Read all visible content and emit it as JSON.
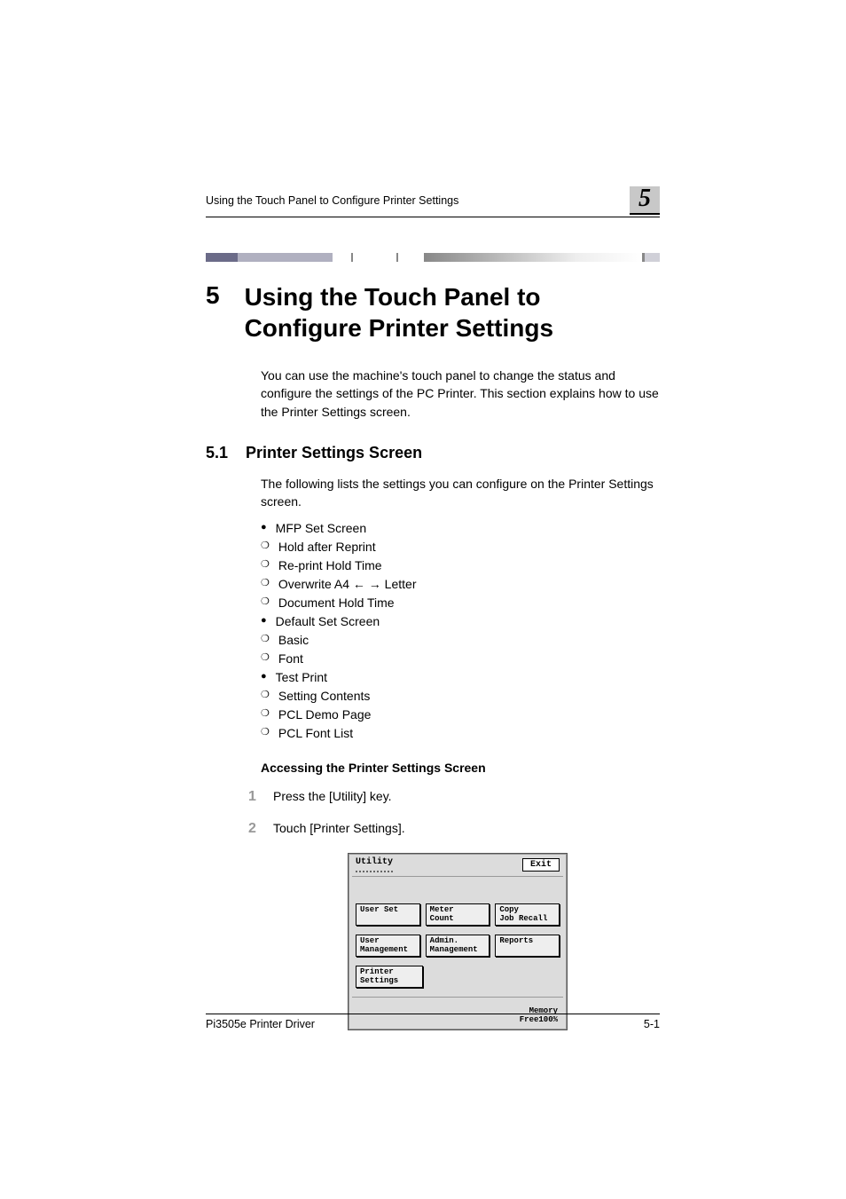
{
  "running_header": {
    "text": "Using the Touch Panel to Configure Printer Settings",
    "chapter_badge": "5"
  },
  "chapter": {
    "number": "5",
    "title": "Using the Touch Panel to Configure Printer Settings"
  },
  "intro": "You can use the machine's touch panel to change the status and configure the settings of the PC Printer. This section explains how to use the Printer Settings screen.",
  "section": {
    "number": "5.1",
    "title": "Printer Settings Screen",
    "para": "The following lists the settings you can configure on the Printer Settings screen."
  },
  "settings": [
    {
      "style": "solid",
      "text": "MFP Set Screen"
    },
    {
      "style": "open",
      "text": "Hold after Reprint"
    },
    {
      "style": "open",
      "text": "Re-print Hold Time"
    },
    {
      "style": "open",
      "text": "Overwrite A4 ← → Letter"
    },
    {
      "style": "open",
      "text": "Document Hold Time"
    },
    {
      "style": "solid",
      "text": "Default Set Screen"
    },
    {
      "style": "open",
      "text": "Basic"
    },
    {
      "style": "open",
      "text": "Font"
    },
    {
      "style": "solid",
      "text": "Test Print"
    },
    {
      "style": "open",
      "text": "Setting Contents"
    },
    {
      "style": "open",
      "text": "PCL Demo Page"
    },
    {
      "style": "open",
      "text": "PCL Font List"
    }
  ],
  "subsection_heading": "Accessing the Printer Settings Screen",
  "steps": [
    {
      "num": "1",
      "text": "Press the [Utility] key."
    },
    {
      "num": "2",
      "text": "Touch [Printer Settings]."
    }
  ],
  "panel": {
    "title": "Utility",
    "exit": "Exit",
    "row1": [
      "User Set",
      "Meter\nCount",
      "Copy\nJob Recall"
    ],
    "row2": [
      "User\nManagement",
      "Admin.\nManagement",
      "Reports"
    ],
    "row3": [
      "Printer\nSettings"
    ],
    "memory_label": "Memory\nFree",
    "memory_value": "100%"
  },
  "footer": {
    "doc": "Pi3505e Printer Driver",
    "page": "5-1"
  }
}
